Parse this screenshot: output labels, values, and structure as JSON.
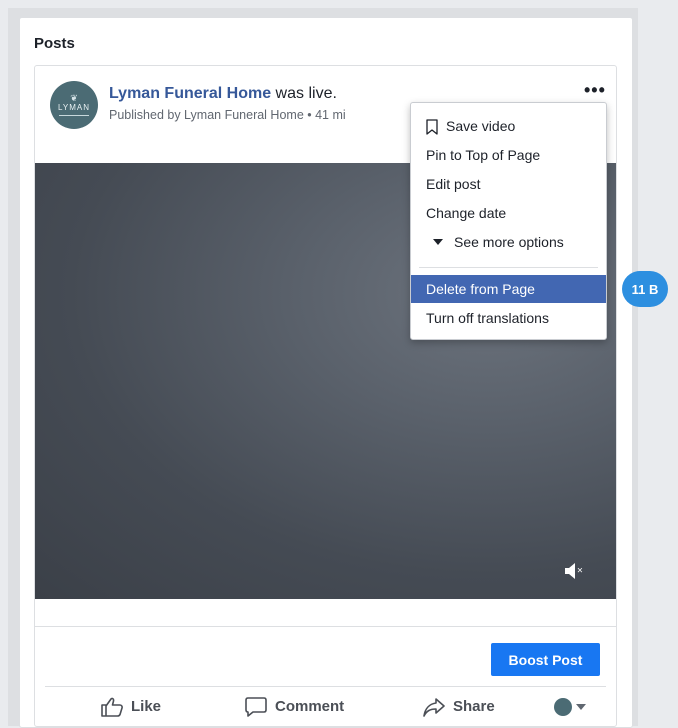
{
  "section": {
    "title": "Posts"
  },
  "post": {
    "avatar_text": "LYMAN",
    "author": "Lyman Funeral Home",
    "action": " was live.",
    "meta": "Published by Lyman Funeral Home  •  41 mi",
    "boost_label": "Boost Post",
    "actions": {
      "like": "Like",
      "comment": "Comment",
      "share": "Share"
    }
  },
  "menu": {
    "items": [
      {
        "label": "Save video",
        "icon": "bookmark-icon"
      },
      {
        "label": "Pin to Top of Page"
      },
      {
        "label": "Edit post"
      },
      {
        "label": "Change date"
      },
      {
        "label": "See more options",
        "icon": "caret-down-icon"
      },
      {
        "label": "Delete from Page",
        "highlighted": true
      },
      {
        "label": "Turn off translations"
      }
    ]
  },
  "badge": {
    "label": "11 B"
  },
  "colors": {
    "link": "#365899",
    "boost": "#1877f2",
    "highlight": "#4267b2",
    "badge": "#2d8fe0"
  }
}
